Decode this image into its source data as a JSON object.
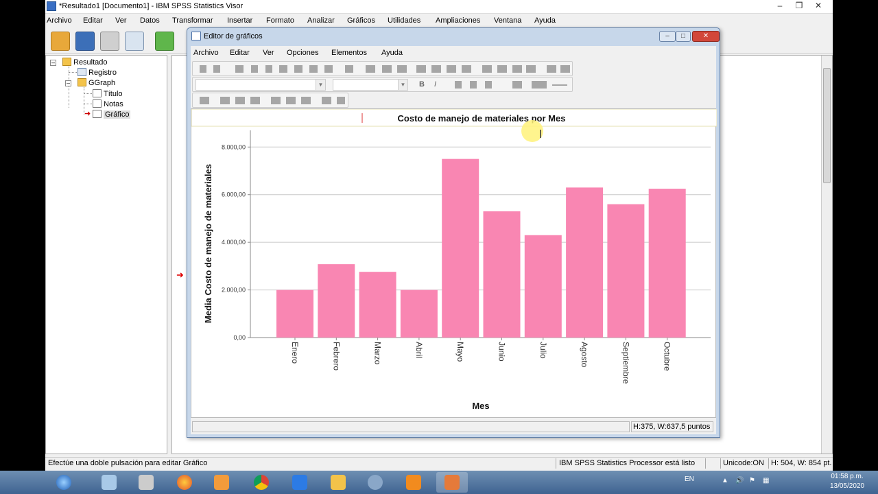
{
  "window": {
    "title": "*Resultado1 [Documento1] - IBM SPSS Statistics Visor"
  },
  "menu": [
    "Archivo",
    "Editar",
    "Ver",
    "Datos",
    "Transformar",
    "Insertar",
    "Formato",
    "Analizar",
    "Gráficos",
    "Utilidades",
    "Ampliaciones",
    "Ventana",
    "Ayuda"
  ],
  "tree": {
    "root": "Resultado",
    "log": "Registro",
    "ggraph": "GGraph",
    "title": "Título",
    "notes": "Notas",
    "chart": "Gráfico"
  },
  "status": {
    "hint": "Efectúe una doble pulsación para editar Gráfico",
    "processor": "IBM SPSS Statistics Processor está listo",
    "unicode": "Unicode:ON",
    "size": "H: 504, W: 854 pt."
  },
  "editor": {
    "title": "Editor de gráficos",
    "menu": [
      "Archivo",
      "Editar",
      "Ver",
      "Opciones",
      "Elementos",
      "Ayuda"
    ],
    "format_bold": "B",
    "format_italic": "I",
    "size_readout": "H:375, W:637,5 puntos"
  },
  "chart_data": {
    "type": "bar",
    "title": "Costo de manejo de materiales por Mes",
    "xlabel": "Mes",
    "ylabel": "Media Costo de manejo de materiales",
    "categories": [
      "Enero",
      "Febrero",
      "Marzo",
      "Abril",
      "Mayo",
      "Junio",
      "Julio",
      "Agosto",
      "Septiembre",
      "Octubre"
    ],
    "values": [
      2000,
      3080,
      2760,
      2000,
      7500,
      5300,
      4300,
      6300,
      5600,
      6250
    ],
    "ylim": [
      0,
      8700
    ],
    "yticks": [
      "0,00",
      "2.000,00",
      "4.000,00",
      "6.000,00",
      "8.000,00"
    ],
    "ytick_values": [
      0,
      2000,
      4000,
      6000,
      8000
    ],
    "bar_color": "#f986b2",
    "grid": true
  },
  "taskbar": {
    "lang": "EN",
    "time": "01:58 p.m.",
    "date": "13/05/2020"
  },
  "colors": {
    "taskbar": "#4a6f9c",
    "editor_frame": "#c7d7ea"
  }
}
